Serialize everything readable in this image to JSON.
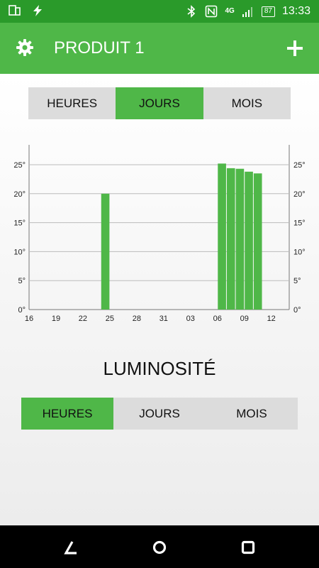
{
  "status_bar": {
    "network": "4G",
    "battery": "87",
    "time": "13:33"
  },
  "app_bar": {
    "title": "PRODUIT 1"
  },
  "period_tabs_top": {
    "tabs": [
      {
        "label": "HEURES",
        "active": false
      },
      {
        "label": "JOURS",
        "active": true
      },
      {
        "label": "MOIS",
        "active": false
      }
    ]
  },
  "chart_data": {
    "type": "bar",
    "x_ticks": [
      "16",
      "19",
      "22",
      "25",
      "28",
      "31",
      "03",
      "06",
      "09",
      "12"
    ],
    "y_ticks": [
      "0°",
      "5°",
      "10°",
      "15°",
      "20°",
      "25°"
    ],
    "ylim": [
      0,
      25
    ],
    "bar_color": "#4fb748",
    "bars": [
      {
        "x": 24,
        "value": 20.0
      },
      {
        "x": 37,
        "value": 25.2
      },
      {
        "x": 38,
        "value": 24.4
      },
      {
        "x": 39,
        "value": 24.3
      },
      {
        "x": 40,
        "value": 23.8
      },
      {
        "x": 41,
        "value": 23.5
      }
    ],
    "x_tick_positions": [
      16,
      19,
      22,
      25,
      28,
      31,
      34,
      37,
      40,
      43
    ],
    "xlim": [
      16,
      45
    ]
  },
  "section": {
    "title": "LUMINOSITÉ"
  },
  "period_tabs_bottom": {
    "tabs": [
      {
        "label": "HEURES",
        "active": true
      },
      {
        "label": "JOURS",
        "active": false
      },
      {
        "label": "MOIS",
        "active": false
      }
    ]
  },
  "colors": {
    "accent": "#4fb748",
    "status_bar": "#2a9a2a",
    "tab_inactive": "#dcdcdc"
  }
}
